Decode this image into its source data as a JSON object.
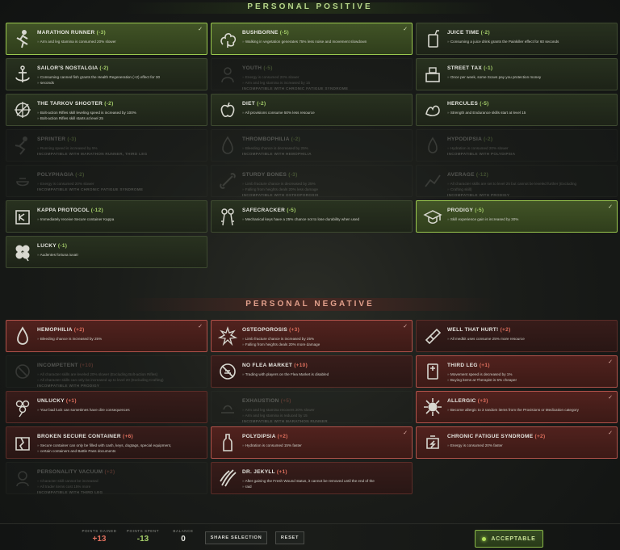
{
  "sections": {
    "positive": "PERSONAL POSITIVE",
    "negative": "PERSONAL NEGATIVE"
  },
  "positive": [
    {
      "name": "MARATHON RUNNER",
      "value": "(-3)",
      "lines": [
        "Arm and leg stamina is consumed 20% slower"
      ],
      "state": "selected",
      "icon": "running-man-icon"
    },
    {
      "name": "BUSHBORNE",
      "value": "(-5)",
      "lines": [
        "Walking in vegetation generates 75% less noise and movement slowdown"
      ],
      "state": "selected",
      "icon": "bush-icon"
    },
    {
      "name": "JUICE TIME",
      "value": "(-2)",
      "lines": [
        "Consuming a juice drink grants the Painkiller effect for 60 seconds"
      ],
      "state": "available",
      "icon": "juice-box-icon"
    },
    {
      "name": "SAILOR'S NOSTALGIA",
      "value": "(-2)",
      "lines": [
        "Consuming canned fish grants the Health Regeneration (+2) effect for 30",
        "seconds"
      ],
      "state": "available",
      "icon": "anchor-icon"
    },
    {
      "name": "YOUTH",
      "value": "(-5)",
      "lines": [
        "Energy is consumed 20% slower",
        "Arm and leg stamina is increased by 15"
      ],
      "incompatible": "INCOMPATIBLE WITH CHRONIC FATIGUE SYNDROME",
      "state": "disabled",
      "icon": "youth-icon"
    },
    {
      "name": "STREET TAX",
      "value": "(-1)",
      "lines": [
        "Once per week, some Scavs pay you protection money"
      ],
      "state": "available",
      "icon": "cash-register-icon"
    },
    {
      "name": "THE TARKOV SHOOTER",
      "value": "(-2)",
      "lines": [
        "Bolt-action Rifles skill leveling speed is increased by 100%",
        "Bolt-action Rifles skill starts at level 25"
      ],
      "state": "available",
      "icon": "crosshair-icon"
    },
    {
      "name": "DIET",
      "value": "(-2)",
      "lines": [
        "All provisions consume 50% less resource"
      ],
      "state": "available",
      "icon": "apple-icon"
    },
    {
      "name": "HERCULES",
      "value": "(-5)",
      "lines": [
        "Strength and Endurance skills start at level 15"
      ],
      "state": "available",
      "icon": "muscle-icon"
    },
    {
      "name": "SPRINTER",
      "value": "(-3)",
      "lines": [
        "Running speed is increased by 5%"
      ],
      "incompatible": "INCOMPATIBLE WITH MARATHON RUNNER, THIRD LEG",
      "state": "disabled",
      "icon": "sprinter-icon"
    },
    {
      "name": "THROMBOPHILIA",
      "value": "(-2)",
      "lines": [
        "Bleeding chance is decreased by 25%"
      ],
      "incompatible": "INCOMPATIBLE WITH HEMOPHILIA",
      "state": "disabled",
      "icon": "blood-icon"
    },
    {
      "name": "HYPODIPSIA",
      "value": "(-2)",
      "lines": [
        "Hydration is consumed 20% slower"
      ],
      "incompatible": "INCOMPATIBLE WITH POLYDIPSIA",
      "state": "disabled",
      "icon": "water-drop-icon"
    },
    {
      "name": "POLYPHAGIA",
      "value": "(-2)",
      "lines": [
        "Energy is consumed 20% slower"
      ],
      "incompatible": "INCOMPATIBLE WITH CHRONIC FATIGUE SYNDROME",
      "state": "disabled",
      "icon": "food-icon"
    },
    {
      "name": "STURDY BONES",
      "value": "(-3)",
      "lines": [
        "Limb fracture chance is decreased by 25%",
        "Falling from heights deals 20% less damage"
      ],
      "incompatible": "INCOMPATIBLE WITH OSTEOPOROSIS",
      "state": "disabled",
      "icon": "bone-icon"
    },
    {
      "name": "AVERAGE",
      "value": "(-12)",
      "lines": [
        "All character skills are set to level 25 but cannot be leveled further (Excluding",
        "Crafting skill)"
      ],
      "incompatible": "INCOMPATIBLE WITH PRODIGY",
      "state": "disabled",
      "icon": "average-icon"
    },
    {
      "name": "KAPPA PROTOCOL",
      "value": "(-12)",
      "lines": [
        "Immediately receive Secure container Kappa"
      ],
      "state": "available",
      "icon": "kappa-container-icon"
    },
    {
      "name": "SAFECRACKER",
      "value": "(-5)",
      "lines": [
        "Mechanical keys have a 25% chance not to lose durability when used"
      ],
      "state": "available",
      "icon": "keys-icon"
    },
    {
      "name": "PRODIGY",
      "value": "(-5)",
      "lines": [
        "Skill experience gain is increased by 30%"
      ],
      "state": "selected",
      "icon": "graduation-cap-icon"
    },
    {
      "name": "LUCKY",
      "value": "(-1)",
      "lines": [
        "Audentes fortuna iuvat!"
      ],
      "state": "available",
      "icon": "four-leaf-clover-icon"
    }
  ],
  "negative": [
    {
      "name": "HEMOPHILIA",
      "value": "(+2)",
      "lines": [
        "Bleeding chance is increased by 25%"
      ],
      "state": "selected",
      "icon": "blood-drop-icon"
    },
    {
      "name": "OSTEOPOROSIS",
      "value": "(+3)",
      "lines": [
        "Limb fracture chance is increased by 25%",
        "Falling from heights deals 20% more damage"
      ],
      "state": "selected",
      "icon": "broken-bone-icon"
    },
    {
      "name": "WELL THAT HURT!",
      "value": "(+2)",
      "lines": [
        "All medkit uses consume 25% more resource"
      ],
      "state": "available",
      "icon": "bandage-icon"
    },
    {
      "name": "INCOMPETENT",
      "value": "(+10)",
      "lines": [
        "All character skills are leveled 20% slower (Excluding Bolt-action Rifles)",
        "All character skills can only be increased up to level 20 (Excluding Crafting)"
      ],
      "incompatible": "INCOMPATIBLE WITH PRODIGY",
      "state": "disabled",
      "icon": "incompetent-icon"
    },
    {
      "name": "NO FLEA MARKET",
      "value": "(+10)",
      "lines": [
        "Trading with players on the Flea Market is disabled"
      ],
      "state": "available",
      "icon": "no-flea-icon"
    },
    {
      "name": "THIRD LEG",
      "value": "(+1)",
      "lines": [
        "Movement speed is decreased by 1%",
        "Buying items at Therapist is 5% cheaper"
      ],
      "state": "selected",
      "icon": "third-leg-icon"
    },
    {
      "name": "UNLUCKY",
      "value": "(+1)",
      "lines": [
        "Your bad luck can sometimes have dire consequences"
      ],
      "state": "available",
      "icon": "wilted-clover-icon"
    },
    {
      "name": "EXHAUSTION",
      "value": "(+5)",
      "lines": [
        "Arm and leg stamina recovers 20% slower",
        "Arm and leg stamina is reduced by 15"
      ],
      "incompatible": "INCOMPATIBLE WITH MARATHON RUNNER",
      "state": "disabled",
      "icon": "exhaustion-icon"
    },
    {
      "name": "ALLERGIC",
      "value": "(+3)",
      "lines": [
        "Become allergic to 3 random items from the Provisions or Medication category"
      ],
      "state": "selected",
      "icon": "allergy-icon"
    },
    {
      "name": "BROKEN SECURE CONTAINER",
      "value": "(+6)",
      "lines": [
        "Secure container can only be filled with cash, keys, dogtags, special equipment,",
        "certain containers and Battle Pass documents"
      ],
      "state": "available",
      "icon": "broken-container-icon"
    },
    {
      "name": "POLYDIPSIA",
      "value": "(+2)",
      "lines": [
        "Hydration is consumed 15% faster"
      ],
      "state": "selected",
      "icon": "bottle-icon"
    },
    {
      "name": "CHRONIC FATIGUE SYNDROME",
      "value": "(+2)",
      "lines": [
        "Energy is consumed 20% faster"
      ],
      "state": "selected",
      "icon": "low-battery-icon"
    },
    {
      "name": "PERSONALITY VACUUM",
      "value": "(+2)",
      "lines": [
        "Character skill cannot be increased",
        "All trader items cost 15% more"
      ],
      "incompatible": "INCOMPATIBLE WITH THIRD LEG",
      "state": "disabled",
      "icon": "vacuum-icon"
    },
    {
      "name": "DR. JEKYLL",
      "value": "(+1)",
      "lines": [
        "After gaining the Fresh Wound status, it cannot be removed until the end of the",
        "raid"
      ],
      "state": "available",
      "icon": "claw-marks-icon"
    }
  ],
  "footer": {
    "points_gained_label": "POINTS GAINED",
    "points_gained": "+13",
    "points_spent_label": "POINTS SPENT",
    "points_spent": "-13",
    "balance_label": "BALANCE",
    "balance": "0",
    "share_label": "SHARE SELECTION",
    "reset_label": "RESET",
    "accept_label": "ACCEPTABLE"
  },
  "colors": {
    "positive_accent": "#9ac84e",
    "negative_accent": "#b0524a",
    "value_positive": "#a6cf6a",
    "value_negative": "#e0705e"
  }
}
